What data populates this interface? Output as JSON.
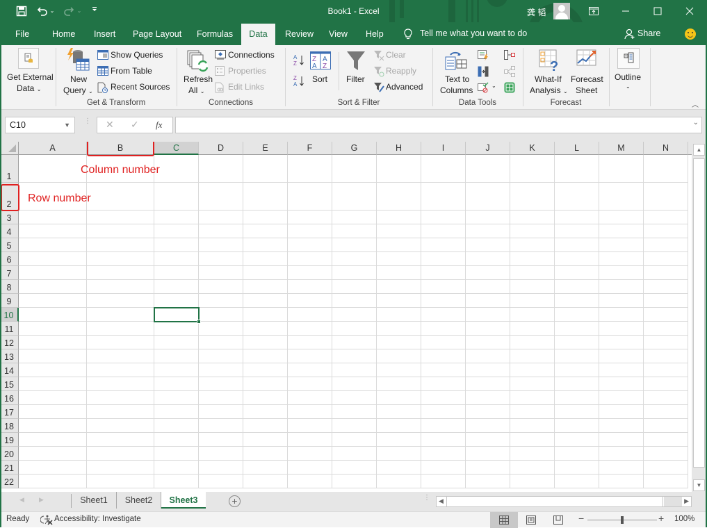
{
  "app": {
    "title": "Book1  -  Excel",
    "user_name": "龚 韬",
    "accent_color": "#217346",
    "annotation_color": "#e02020"
  },
  "quick_access": {
    "save": "save-icon",
    "undo": "undo-icon",
    "redo": "redo-icon",
    "customize": "customize-qat-icon"
  },
  "window_controls": [
    "ribbon-display-options-icon",
    "minimize-icon",
    "maximize-icon",
    "close-icon"
  ],
  "tabs": [
    {
      "label": "File"
    },
    {
      "label": "Home"
    },
    {
      "label": "Insert"
    },
    {
      "label": "Page Layout"
    },
    {
      "label": "Formulas"
    },
    {
      "label": "Data",
      "active": true
    },
    {
      "label": "Review"
    },
    {
      "label": "View"
    },
    {
      "label": "Help"
    }
  ],
  "tell_me": "Tell me what you want to do",
  "share": "Share",
  "ribbon": {
    "get_external_data": {
      "line1": "Get External",
      "line2": "Data"
    },
    "get_transform": {
      "label": "Get & Transform",
      "new_query": {
        "line1": "New",
        "line2": "Query"
      },
      "show_queries": "Show Queries",
      "from_table": "From Table",
      "recent_sources": "Recent Sources"
    },
    "connections": {
      "label": "Connections",
      "refresh_all": {
        "line1": "Refresh",
        "line2": "All"
      },
      "connections": "Connections",
      "properties": "Properties",
      "edit_links": "Edit Links"
    },
    "sort_filter": {
      "label": "Sort & Filter",
      "sort": "Sort",
      "filter": "Filter",
      "clear": "Clear",
      "reapply": "Reapply",
      "advanced": "Advanced"
    },
    "data_tools": {
      "label": "Data Tools",
      "text_to_columns": {
        "line1": "Text to",
        "line2": "Columns"
      }
    },
    "forecast": {
      "label": "Forecast",
      "what_if": {
        "line1": "What-If",
        "line2": "Analysis"
      },
      "forecast_sheet": {
        "line1": "Forecast",
        "line2": "Sheet"
      }
    },
    "outline": {
      "label": "Outline"
    }
  },
  "formula_bar": {
    "name_box": "C10",
    "cancel": "✕",
    "enter": "✓",
    "fx": "fx",
    "value": ""
  },
  "grid": {
    "columns": [
      "A",
      "B",
      "C",
      "D",
      "E",
      "F",
      "G",
      "H",
      "I",
      "J",
      "K",
      "L",
      "M",
      "N"
    ],
    "rows": [
      "1",
      "2",
      "3",
      "4",
      "5",
      "6",
      "7",
      "8",
      "9",
      "10",
      "11",
      "12",
      "13",
      "14",
      "15",
      "16",
      "17",
      "18",
      "19",
      "20",
      "21",
      "22"
    ],
    "selected_cell": "C10",
    "selected_column": "C",
    "selected_row": "10"
  },
  "annotations": {
    "column": "Column number",
    "row": "Row number"
  },
  "sheets": [
    {
      "label": "Sheet1"
    },
    {
      "label": "Sheet2"
    },
    {
      "label": "Sheet3",
      "active": true
    }
  ],
  "status": {
    "ready": "Ready",
    "accessibility": "Accessibility: Investigate",
    "zoom": "100%",
    "zoom_fraction": 0.5
  }
}
